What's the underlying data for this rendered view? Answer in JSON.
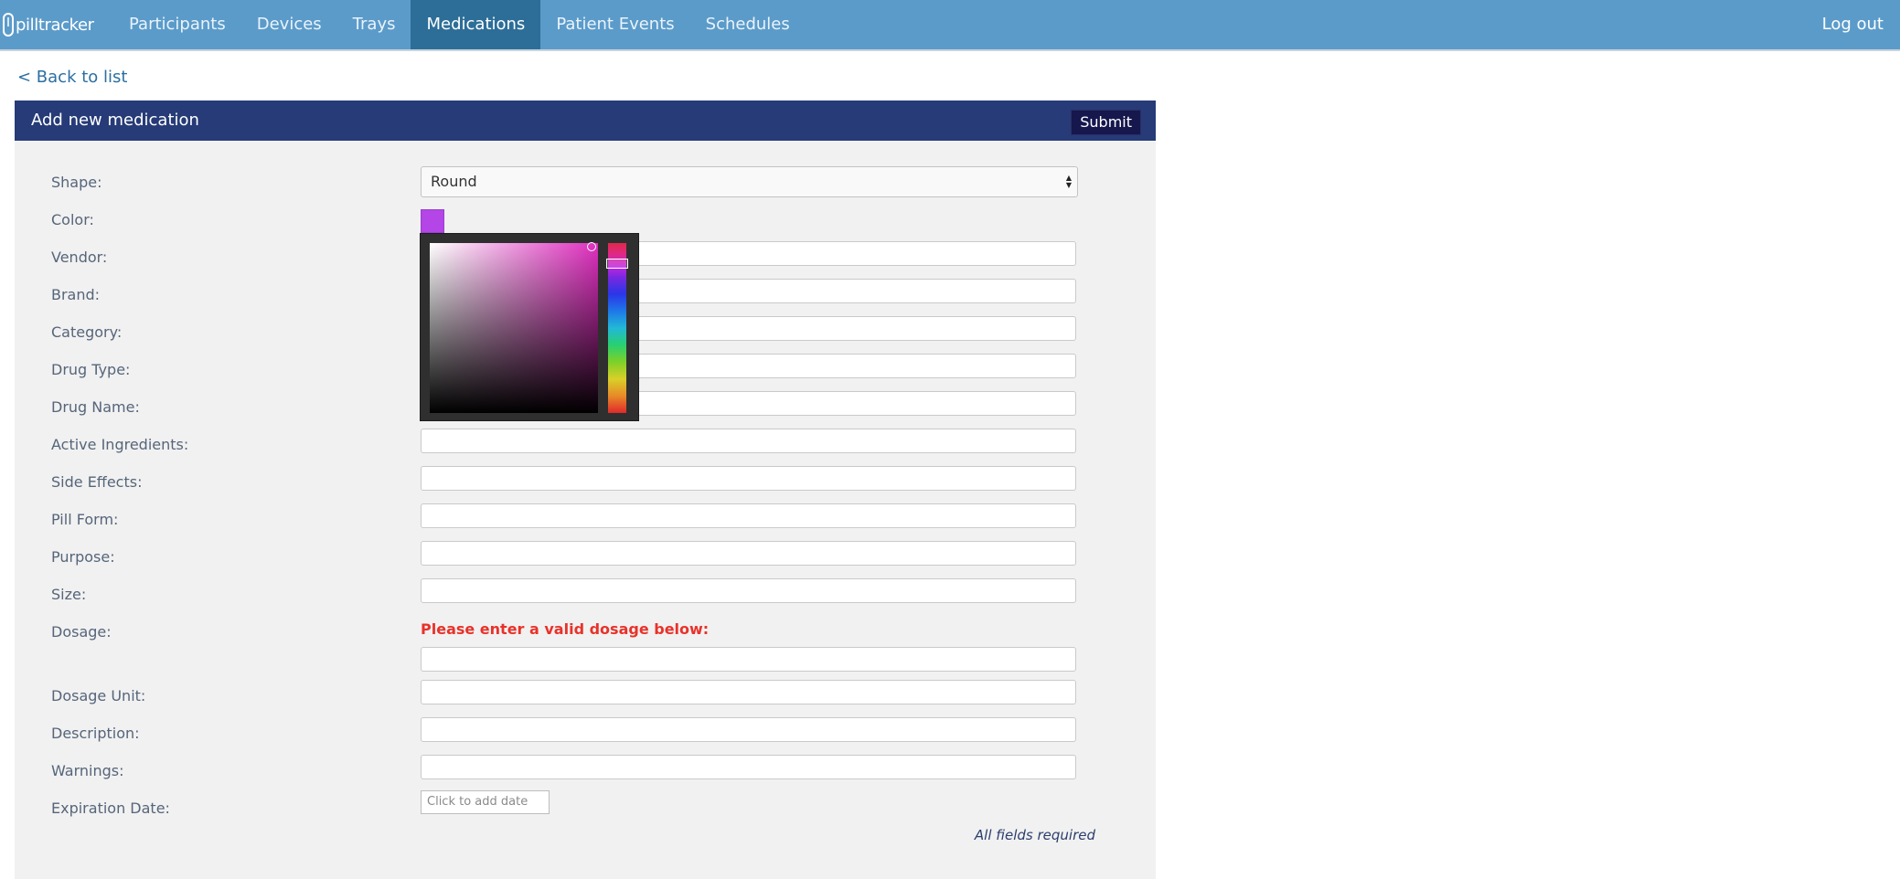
{
  "app": {
    "logo_text": "pilltracker",
    "nav": [
      "Participants",
      "Devices",
      "Trays",
      "Medications",
      "Patient Events",
      "Schedules"
    ],
    "active_nav": "Medications",
    "logout_label": "Log out"
  },
  "back_link": "< Back to list",
  "form": {
    "title": "Add new medication",
    "submit_label": "Submit",
    "shape_label": "Shape:",
    "shape_value": "Round",
    "color_label": "Color:",
    "color_value": "#b445e6",
    "labels": {
      "vendor": "Vendor:",
      "brand": "Brand:",
      "category": "Category:",
      "drug_type": "Drug Type:",
      "drug_name": "Drug Name:",
      "active_ingredients": "Active Ingredients:",
      "side_effects": "Side Effects:",
      "pill_form": "Pill Form:",
      "purpose": "Purpose:",
      "size": "Size:",
      "dosage": "Dosage:",
      "dosage_unit": "Dosage Unit:",
      "description": "Description:",
      "warnings": "Warnings:",
      "expiration_date": "Expiration Date:"
    },
    "dosage_error": "Please enter a valid dosage below:",
    "date_placeholder": "Click to add date",
    "footer_note": "All fields required"
  },
  "colors": {
    "nav_bg": "#5b9bca",
    "nav_active": "#2d6e98",
    "header_bg": "#263b77",
    "submit_bg": "#15174d",
    "error": "#e8322a"
  }
}
